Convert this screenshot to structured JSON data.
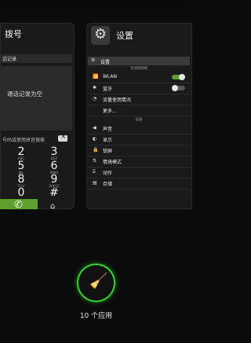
{
  "dialer": {
    "title": "拨号",
    "tab": "话记录",
    "empty_text": "通话记录为空",
    "search_hint": "号码或使用拼音搜索",
    "keys": [
      {
        "digit": "2",
        "sub": "ABC"
      },
      {
        "digit": "3",
        "sub": "DEF"
      },
      {
        "digit": "5",
        "sub": "JKL"
      },
      {
        "digit": "6",
        "sub": "MNO"
      },
      {
        "digit": "8",
        "sub": "TUV"
      },
      {
        "digit": "9",
        "sub": "WXYZ"
      },
      {
        "digit": "0",
        "sub": "+"
      },
      {
        "digit": "#",
        "sub": ""
      }
    ],
    "call_icon": "phone-icon",
    "bottom_icons": [
      "person-icon",
      "star-icon",
      "group-icon"
    ]
  },
  "settings": {
    "title": "设置",
    "header_label": "设置",
    "section_wireless": "无线和网络",
    "section_device": "设备",
    "rows": [
      {
        "icon": "wifi-icon",
        "glyph": "📶",
        "label": "WLAN",
        "toggle": "on"
      },
      {
        "icon": "bluetooth-icon",
        "glyph": "✱",
        "label": "蓝牙",
        "toggle": "off"
      },
      {
        "icon": "data-usage-icon",
        "glyph": "◔",
        "label": "流量使用情况"
      },
      {
        "icon": "",
        "glyph": "",
        "label": "更多..."
      },
      {
        "icon": "sound-icon",
        "glyph": "◀",
        "label": "声音"
      },
      {
        "icon": "display-icon",
        "glyph": "◐",
        "label": "显示"
      },
      {
        "icon": "lock-icon",
        "glyph": "🔒",
        "label": "锁屏"
      },
      {
        "icon": "scene-icon",
        "glyph": "⇅",
        "label": "情境模式"
      },
      {
        "icon": "motion-icon",
        "glyph": "⌸",
        "label": "动作"
      },
      {
        "icon": "storage-icon",
        "glyph": "▤",
        "label": "存储"
      }
    ],
    "colors": {
      "toggle_on": "#5fa02c",
      "toggle_off": "#555555"
    }
  },
  "cleaner": {
    "icon": "broom-icon",
    "accent": "#2fd12f"
  },
  "app_count": "10 个应用"
}
